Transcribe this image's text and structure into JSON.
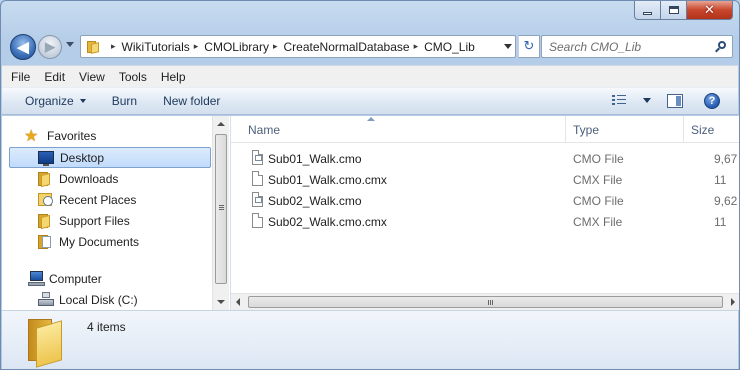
{
  "window": {
    "minimize_label": "",
    "maximize_label": "",
    "close_glyph": "✕"
  },
  "nav": {
    "back_glyph": "◀",
    "forward_glyph": "▶"
  },
  "breadcrumbs": [
    "WikiTutorials",
    "CMOLibrary",
    "CreateNormalDatabase",
    "CMO_Lib"
  ],
  "breadcrumb_separator": "▸",
  "refresh_glyph": "↻",
  "search": {
    "placeholder": "Search CMO_Lib"
  },
  "menu": [
    "File",
    "Edit",
    "View",
    "Tools",
    "Help"
  ],
  "toolbar": {
    "organize": "Organize",
    "burn": "Burn",
    "new_folder": "New folder",
    "help_glyph": "?"
  },
  "sidebar": {
    "items": [
      {
        "label": "Favorites",
        "icon": "star-icon"
      },
      {
        "label": "Desktop",
        "icon": "desktop-icon"
      },
      {
        "label": "Downloads",
        "icon": "folder-icon"
      },
      {
        "label": "Recent Places",
        "icon": "recent-places-icon"
      },
      {
        "label": "Support Files",
        "icon": "folder-icon"
      },
      {
        "label": "My Documents",
        "icon": "documents-icon"
      },
      {
        "label": "Computer",
        "icon": "computer-icon"
      },
      {
        "label": "Local Disk (C:)",
        "icon": "disk-icon"
      }
    ],
    "star_glyph": "★"
  },
  "columns": {
    "name": "Name",
    "type": "Type",
    "size": "Size"
  },
  "files": [
    {
      "name": "Sub01_Walk.cmo",
      "type": "CMO File",
      "size": "9,67",
      "icon": "cmo-file-icon"
    },
    {
      "name": "Sub01_Walk.cmo.cmx",
      "type": "CMX File",
      "size": "11",
      "icon": "cmx-file-icon"
    },
    {
      "name": "Sub02_Walk.cmo",
      "type": "CMO File",
      "size": "9,62",
      "icon": "cmo-file-icon"
    },
    {
      "name": "Sub02_Walk.cmo.cmx",
      "type": "CMX File",
      "size": "11",
      "icon": "cmx-file-icon"
    }
  ],
  "status": {
    "item_count": "4 items"
  },
  "colors": {
    "accent": "#1e395b",
    "selection": "#c1dbfc",
    "frame": "#b9d1ea"
  }
}
